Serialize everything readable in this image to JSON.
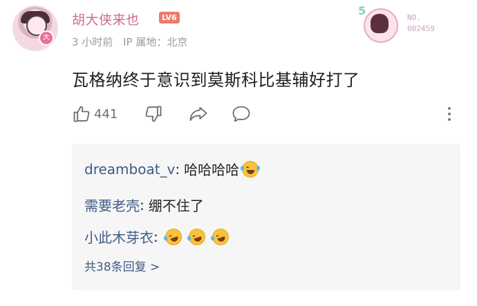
{
  "post": {
    "username": "胡大侠来也",
    "level": "LV6",
    "time": "3 小时前",
    "ip_location": "IP 属地：北京",
    "content": "瓦格纳终于意识到莫斯科比基辅好打了",
    "fan_badge": {
      "number_label": "5",
      "line1": "NO.",
      "line2": "002459"
    },
    "like_count": "441"
  },
  "icons": {
    "like": "thumbs-up-icon",
    "dislike": "thumbs-down-icon",
    "share": "share-icon",
    "comment": "comment-icon",
    "more": "more-vertical-icon"
  },
  "replies": [
    {
      "user": "dreamboat_v",
      "sep": ":",
      "text": "哈哈哈哈",
      "emoji": "grinning-squinting-tears"
    },
    {
      "user": "需要老壳",
      "sep": ":",
      "text": "绷不住了",
      "emoji": ""
    },
    {
      "user": "小此木芽衣",
      "sep": ":",
      "text": "",
      "emoji": "rolling-on-floor-laughing x3"
    }
  ],
  "more_replies": "共38条回复 >"
}
